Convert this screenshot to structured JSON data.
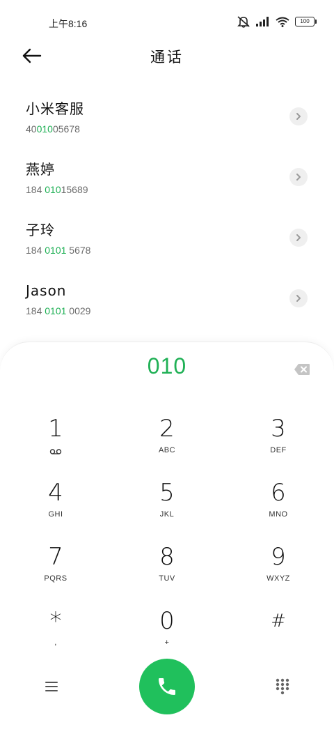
{
  "status_bar": {
    "time": "上午8:16",
    "battery": "100",
    "icons": [
      "mute-bell-icon",
      "signal-icon",
      "wifi-icon",
      "battery-icon"
    ]
  },
  "header": {
    "title": "通话",
    "back_icon": "back-arrow-icon"
  },
  "contacts": [
    {
      "name": "小米客服",
      "number_pre": "40",
      "number_hl": "010",
      "number_post": "05678"
    },
    {
      "name": "燕婷",
      "number_pre": "184 ",
      "number_hl": "010",
      "number_post": "15689"
    },
    {
      "name": "子玲",
      "number_pre": "184 ",
      "number_hl": "0101",
      "number_post": " 5678"
    },
    {
      "name": "Jason",
      "number_pre": "184 ",
      "number_hl": "0101",
      "number_post": " 0029"
    }
  ],
  "dialer": {
    "input": "010",
    "keys": [
      {
        "digit": "1",
        "sub": ""
      },
      {
        "digit": "2",
        "sub": "ABC"
      },
      {
        "digit": "3",
        "sub": "DEF"
      },
      {
        "digit": "4",
        "sub": "GHI"
      },
      {
        "digit": "5",
        "sub": "JKL"
      },
      {
        "digit": "6",
        "sub": "MNO"
      },
      {
        "digit": "7",
        "sub": "PQRS"
      },
      {
        "digit": "8",
        "sub": "TUV"
      },
      {
        "digit": "9",
        "sub": "WXYZ"
      },
      {
        "digit": "*",
        "sub": ","
      },
      {
        "digit": "0",
        "sub": "+"
      },
      {
        "digit": "#",
        "sub": ""
      }
    ]
  },
  "colors": {
    "accent": "#1fb055",
    "call_button": "#20c05c"
  }
}
